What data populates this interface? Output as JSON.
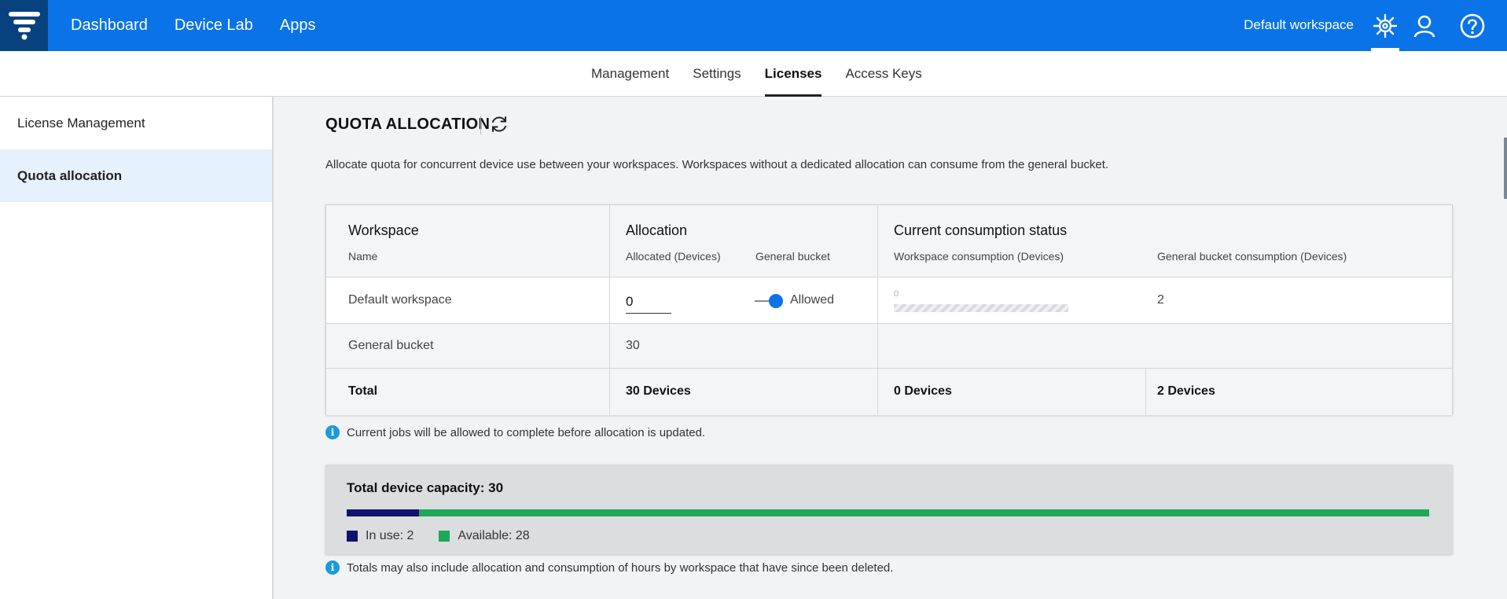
{
  "topbar": {
    "nav": [
      "Dashboard",
      "Device Lab",
      "Apps"
    ],
    "workspace_label": "Default workspace",
    "icons": [
      "gear-icon",
      "user-icon",
      "help-icon"
    ]
  },
  "tabs": [
    {
      "label": "Management",
      "active": false
    },
    {
      "label": "Settings",
      "active": false
    },
    {
      "label": "Licenses",
      "active": true
    },
    {
      "label": "Access Keys",
      "active": false
    }
  ],
  "sidebar": {
    "items": [
      {
        "label": "License Management",
        "active": false
      },
      {
        "label": "Quota allocation",
        "active": true
      }
    ]
  },
  "main": {
    "title": "QUOTA ALLOCATION",
    "intro": "Allocate quota for concurrent device use between your workspaces. Workspaces without a dedicated allocation can consume from the general bucket.",
    "table": {
      "headers": {
        "workspace": "Workspace",
        "workspace_sub": "Name",
        "allocation": "Allocation",
        "allocated_sub": "Allocated (Devices)",
        "general_bucket_sub": "General bucket",
        "consumption": "Current consumption status",
        "ws_consumption_sub": "Workspace consumption (Devices)",
        "gb_consumption_sub": "General bucket consumption (Devices)"
      },
      "rows": [
        {
          "name": "Default workspace",
          "allocated": "0",
          "general_bucket": "Allowed",
          "ws_consumption": "0",
          "gb_consumption": "2"
        },
        {
          "name": "General bucket",
          "allocated": "30"
        }
      ],
      "total": {
        "label": "Total",
        "allocation": "30 Devices",
        "ws_consumption": "0 Devices",
        "gb_consumption": "2 Devices"
      }
    },
    "note_jobs": "Current jobs will be allowed to complete before allocation is updated.",
    "capacity": {
      "title": "Total device capacity: 30",
      "total": 30,
      "in_use": 2,
      "in_use_label": "In use: 2",
      "available_label": "Available: 28",
      "colors": {
        "in_use": "#10136e",
        "available": "#1da85a"
      }
    },
    "note_totals": "Totals may also include allocation and consumption of hours by workspace that have since been deleted."
  }
}
